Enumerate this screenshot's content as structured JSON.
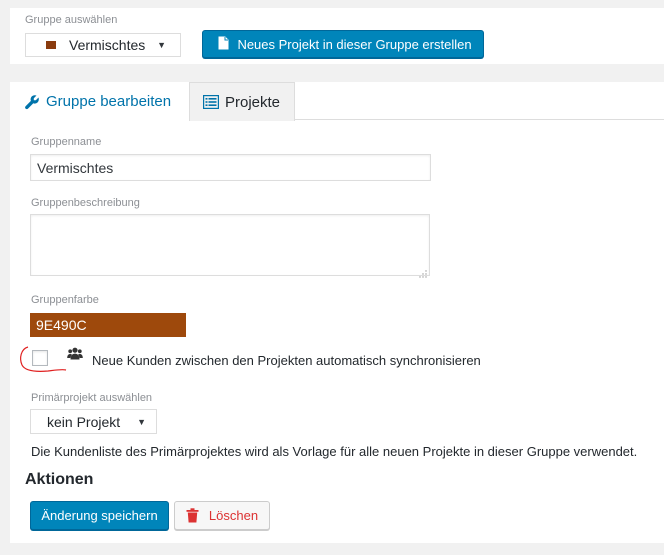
{
  "group_select": {
    "label": "Gruppe auswählen",
    "value": "Vermischtes",
    "folder_color": "#8a3b0e"
  },
  "new_project_button": {
    "label": "Neues Projekt in dieser Gruppe erstellen"
  },
  "tabs": [
    {
      "label": "Gruppe bearbeiten",
      "icon": "wrench-icon",
      "active": true
    },
    {
      "label": "Projekte",
      "icon": "list-icon",
      "active": false
    }
  ],
  "form": {
    "group_name": {
      "label": "Gruppenname",
      "value": "Vermischtes"
    },
    "group_description": {
      "label": "Gruppenbeschreibung",
      "value": ""
    },
    "group_color": {
      "label": "Gruppenfarbe",
      "value": "9E490C",
      "color": "#9E490C"
    },
    "sync_customers": {
      "label": "Neue Kunden zwischen den Projekten automatisch synchronisieren",
      "checked": false,
      "icon": "users-icon"
    },
    "primary_project": {
      "label": "Primärprojekt auswählen",
      "value": "kein Projekt",
      "help": "Die Kundenliste des Primärprojektes wird als Vorlage für alle neuen Projekte in dieser Gruppe verwendet."
    }
  },
  "actions": {
    "title": "Aktionen",
    "save_label": "Änderung speichern",
    "delete_label": "Löschen"
  },
  "colors": {
    "primary": "#0085ba",
    "danger": "#dc3232",
    "annotation": "#e02020"
  }
}
